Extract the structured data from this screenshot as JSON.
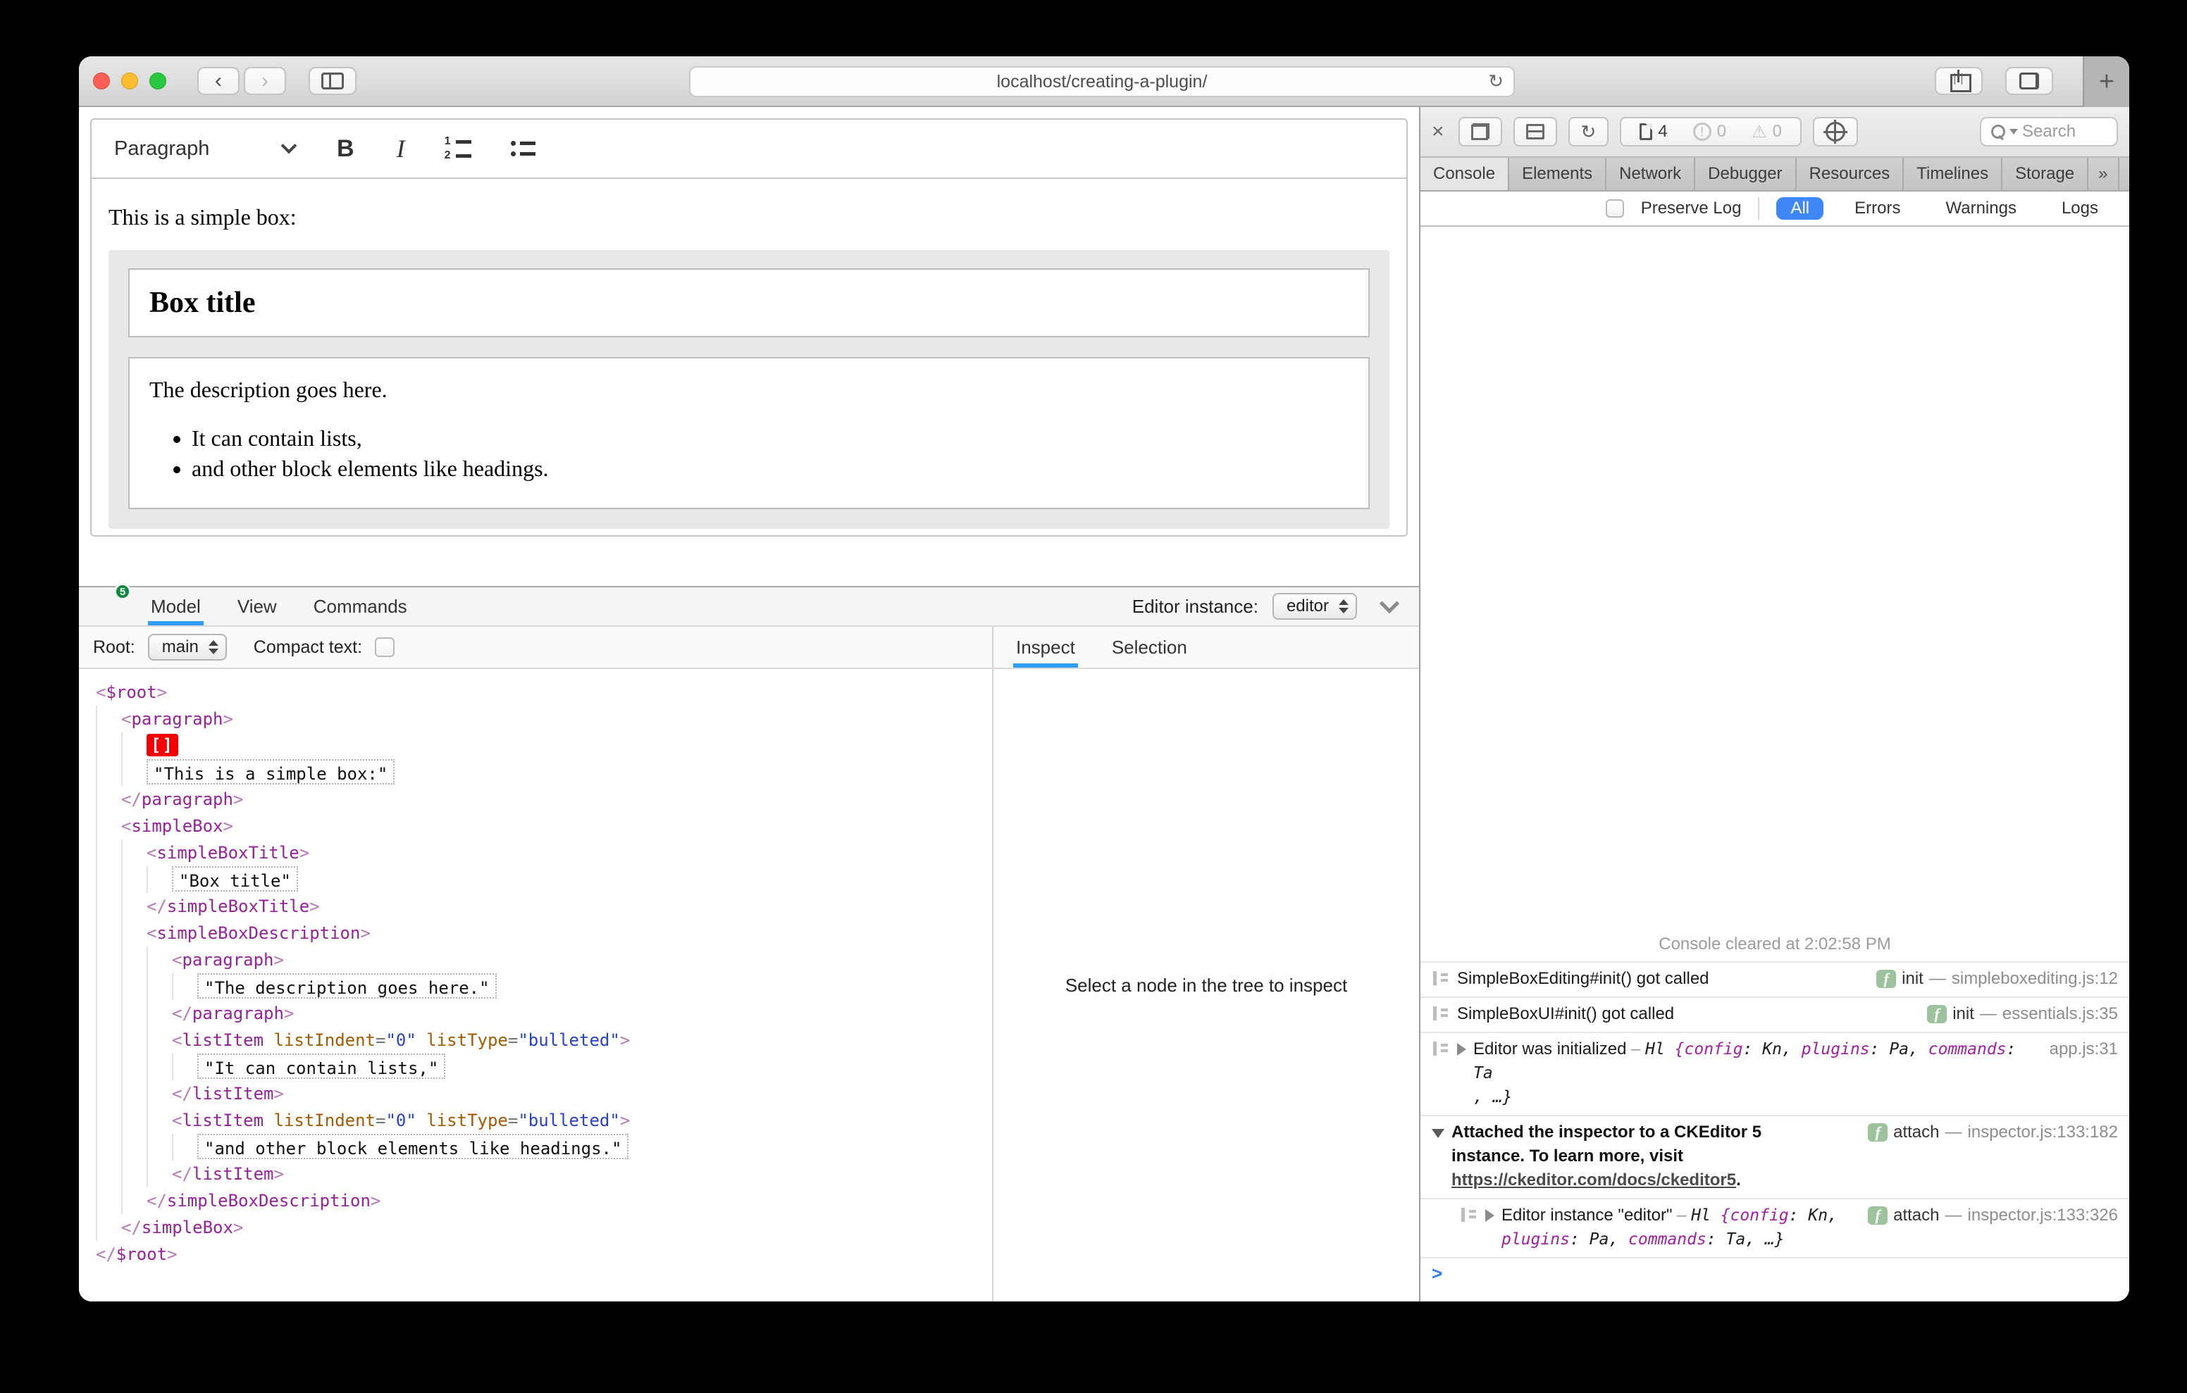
{
  "browser": {
    "url": "localhost/creating-a-plugin/",
    "reload_glyph": "↻",
    "back_glyph": "‹",
    "forward_glyph": "›",
    "new_tab_glyph": "+"
  },
  "editor": {
    "toolbar": {
      "paragraph": "Paragraph",
      "bold": "B",
      "italic": "I"
    },
    "content": {
      "paragraph": "This is a simple box:",
      "box_title": "Box title",
      "box_description": "The description goes here.",
      "list": [
        "It can contain lists,",
        "and other block elements like headings."
      ]
    }
  },
  "inspector": {
    "logo_badge": "5",
    "tabs": [
      "Model",
      "View",
      "Commands"
    ],
    "editor_instance_label": "Editor instance:",
    "editor_instance_value": "editor",
    "root_label": "Root:",
    "root_value": "main",
    "compact_label": "Compact text:",
    "side_tabs": [
      "Inspect",
      "Selection"
    ],
    "empty_message": "Select a node in the tree to inspect",
    "tree": [
      {
        "indent": 0,
        "parts": [
          {
            "s": "br",
            "t": "<"
          },
          {
            "s": "tg",
            "t": "$root"
          },
          {
            "s": "br",
            "t": ">"
          }
        ]
      },
      {
        "indent": 1,
        "parts": [
          {
            "s": "br",
            "t": "<"
          },
          {
            "s": "tg",
            "t": "paragraph"
          },
          {
            "s": "br",
            "t": ">"
          }
        ]
      },
      {
        "indent": 2,
        "parts": [
          {
            "s": "mk",
            "t": "[]"
          }
        ]
      },
      {
        "indent": 2,
        "parts": [
          {
            "s": "str",
            "t": "\"This is a simple box:\""
          }
        ]
      },
      {
        "indent": 1,
        "parts": [
          {
            "s": "br",
            "t": "</"
          },
          {
            "s": "tg",
            "t": "paragraph"
          },
          {
            "s": "br",
            "t": ">"
          }
        ]
      },
      {
        "indent": 1,
        "parts": [
          {
            "s": "br",
            "t": "<"
          },
          {
            "s": "tg",
            "t": "simpleBox"
          },
          {
            "s": "br",
            "t": ">"
          }
        ]
      },
      {
        "indent": 2,
        "parts": [
          {
            "s": "br",
            "t": "<"
          },
          {
            "s": "tg",
            "t": "simpleBoxTitle"
          },
          {
            "s": "br",
            "t": ">"
          }
        ]
      },
      {
        "indent": 3,
        "parts": [
          {
            "s": "str",
            "t": "\"Box title\""
          }
        ]
      },
      {
        "indent": 2,
        "parts": [
          {
            "s": "br",
            "t": "</"
          },
          {
            "s": "tg",
            "t": "simpleBoxTitle"
          },
          {
            "s": "br",
            "t": ">"
          }
        ]
      },
      {
        "indent": 2,
        "parts": [
          {
            "s": "br",
            "t": "<"
          },
          {
            "s": "tg",
            "t": "simpleBoxDescription"
          },
          {
            "s": "br",
            "t": ">"
          }
        ]
      },
      {
        "indent": 3,
        "parts": [
          {
            "s": "br",
            "t": "<"
          },
          {
            "s": "tg",
            "t": "paragraph"
          },
          {
            "s": "br",
            "t": ">"
          }
        ]
      },
      {
        "indent": 4,
        "parts": [
          {
            "s": "str",
            "t": "\"The description goes here.\""
          }
        ]
      },
      {
        "indent": 3,
        "parts": [
          {
            "s": "br",
            "t": "</"
          },
          {
            "s": "tg",
            "t": "paragraph"
          },
          {
            "s": "br",
            "t": ">"
          }
        ]
      },
      {
        "indent": 3,
        "parts": [
          {
            "s": "br",
            "t": "<"
          },
          {
            "s": "tg",
            "t": "listItem"
          },
          {
            "s": "pl",
            "t": " "
          },
          {
            "s": "at",
            "t": "listIndent"
          },
          {
            "s": "eq",
            "t": "="
          },
          {
            "s": "vl",
            "t": "\"0\""
          },
          {
            "s": "pl",
            "t": " "
          },
          {
            "s": "at",
            "t": "listType"
          },
          {
            "s": "eq",
            "t": "="
          },
          {
            "s": "vl",
            "t": "\"bulleted\""
          },
          {
            "s": "br",
            "t": ">"
          }
        ]
      },
      {
        "indent": 4,
        "parts": [
          {
            "s": "str",
            "t": "\"It can contain lists,\""
          }
        ]
      },
      {
        "indent": 3,
        "parts": [
          {
            "s": "br",
            "t": "</"
          },
          {
            "s": "tg",
            "t": "listItem"
          },
          {
            "s": "br",
            "t": ">"
          }
        ]
      },
      {
        "indent": 3,
        "parts": [
          {
            "s": "br",
            "t": "<"
          },
          {
            "s": "tg",
            "t": "listItem"
          },
          {
            "s": "pl",
            "t": " "
          },
          {
            "s": "at",
            "t": "listIndent"
          },
          {
            "s": "eq",
            "t": "="
          },
          {
            "s": "vl",
            "t": "\"0\""
          },
          {
            "s": "pl",
            "t": " "
          },
          {
            "s": "at",
            "t": "listType"
          },
          {
            "s": "eq",
            "t": "="
          },
          {
            "s": "vl",
            "t": "\"bulleted\""
          },
          {
            "s": "br",
            "t": ">"
          }
        ]
      },
      {
        "indent": 4,
        "parts": [
          {
            "s": "str",
            "t": "\"and other block elements like headings.\""
          }
        ]
      },
      {
        "indent": 3,
        "parts": [
          {
            "s": "br",
            "t": "</"
          },
          {
            "s": "tg",
            "t": "listItem"
          },
          {
            "s": "br",
            "t": ">"
          }
        ]
      },
      {
        "indent": 2,
        "parts": [
          {
            "s": "br",
            "t": "</"
          },
          {
            "s": "tg",
            "t": "simpleBoxDescription"
          },
          {
            "s": "br",
            "t": ">"
          }
        ]
      },
      {
        "indent": 1,
        "parts": [
          {
            "s": "br",
            "t": "</"
          },
          {
            "s": "tg",
            "t": "simpleBox"
          },
          {
            "s": "br",
            "t": ">"
          }
        ]
      },
      {
        "indent": 0,
        "parts": [
          {
            "s": "br",
            "t": "</"
          },
          {
            "s": "tg",
            "t": "$root"
          },
          {
            "s": "br",
            "t": ">"
          }
        ]
      }
    ]
  },
  "devtools": {
    "toolbar": {
      "resource_count": "4",
      "error_count": "0",
      "warning_count": "0",
      "search_placeholder": "Search",
      "close_glyph": "×",
      "reload_glyph": "↻",
      "bang_glyph": "!",
      "warn_glyph": "⚠"
    },
    "tabs": [
      "Console",
      "Elements",
      "Network",
      "Debugger",
      "Resources",
      "Timelines",
      "Storage"
    ],
    "active_tab": "Console",
    "more_glyph": "»",
    "add_glyph": "+",
    "gear_glyph": "⚙",
    "filter": {
      "preserve_label": "Preserve Log",
      "options": [
        "All",
        "Errors",
        "Warnings",
        "Logs"
      ],
      "active": "All"
    },
    "cleared_message": "Console cleared at 2:02:58 PM",
    "prompt_glyph": ">",
    "messages": [
      {
        "icon": true,
        "disclosure": null,
        "indent": false,
        "lines": [
          [
            {
              "s": "p",
              "t": "SimpleBoxEditing#init() got called"
            }
          ]
        ],
        "right": {
          "fn": "init",
          "dash": "—",
          "loc": "simpleboxediting.js:12"
        }
      },
      {
        "icon": true,
        "disclosure": null,
        "indent": false,
        "lines": [
          [
            {
              "s": "p",
              "t": "SimpleBoxUI#init() got called"
            }
          ]
        ],
        "right": {
          "fn": "init",
          "dash": "—",
          "loc": "essentials.js:35"
        }
      },
      {
        "icon": true,
        "disclosure": "right",
        "indent": false,
        "lines": [
          [
            {
              "s": "p",
              "t": "Editor was initialized"
            },
            {
              "s": "dim",
              "t": " – "
            },
            {
              "s": "m",
              "t": "Hl "
            },
            {
              "s": "prop",
              "t": "{config"
            },
            {
              "s": "m",
              "t": ": Kn, "
            },
            {
              "s": "prop",
              "t": "plugins"
            },
            {
              "s": "m",
              "t": ": Pa, "
            },
            {
              "s": "prop",
              "t": "commands"
            },
            {
              "s": "m",
              "t": ": Ta"
            }
          ],
          [
            {
              "s": "m",
              "t": ", …}"
            }
          ]
        ],
        "right": {
          "fn": null,
          "dash": null,
          "loc": "app.js:31"
        }
      },
      {
        "icon": false,
        "disclosure": "down",
        "indent": false,
        "lines": [
          [
            {
              "s": "b",
              "t": "Attached the inspector to a CKEditor 5"
            }
          ],
          [
            {
              "s": "b",
              "t": "instance. To learn more, visit"
            }
          ],
          [
            {
              "s": "link",
              "t": "https://ckeditor.com/docs/ckeditor5"
            },
            {
              "s": "b",
              "t": "."
            }
          ]
        ],
        "right": {
          "fn": "attach",
          "dash": "—",
          "loc": "inspector.js:133:182"
        }
      },
      {
        "icon": true,
        "disclosure": "right",
        "indent": true,
        "lines": [
          [
            {
              "s": "p",
              "t": "Editor instance \"editor\""
            },
            {
              "s": "dim",
              "t": " – "
            },
            {
              "s": "m",
              "t": "Hl "
            },
            {
              "s": "prop",
              "t": "{config"
            },
            {
              "s": "m",
              "t": ": Kn,"
            }
          ],
          [
            {
              "s": "prop",
              "t": "plugins"
            },
            {
              "s": "m",
              "t": ": Pa, "
            },
            {
              "s": "prop",
              "t": "commands"
            },
            {
              "s": "m",
              "t": ": Ta, …}"
            }
          ]
        ],
        "right": {
          "fn": "attach",
          "dash": "—",
          "loc": "inspector.js:133:326"
        }
      }
    ]
  },
  "colors": {
    "accent_blue": "#2f9df4",
    "filter_pill_blue": "#3f87f5",
    "tree_tag": "#98219b",
    "tree_attr": "#a35a00",
    "tree_value": "#2742c9",
    "marker_red": "#f50000",
    "logo_green": "#2bb14c",
    "badge_green": "#9cc39c"
  }
}
